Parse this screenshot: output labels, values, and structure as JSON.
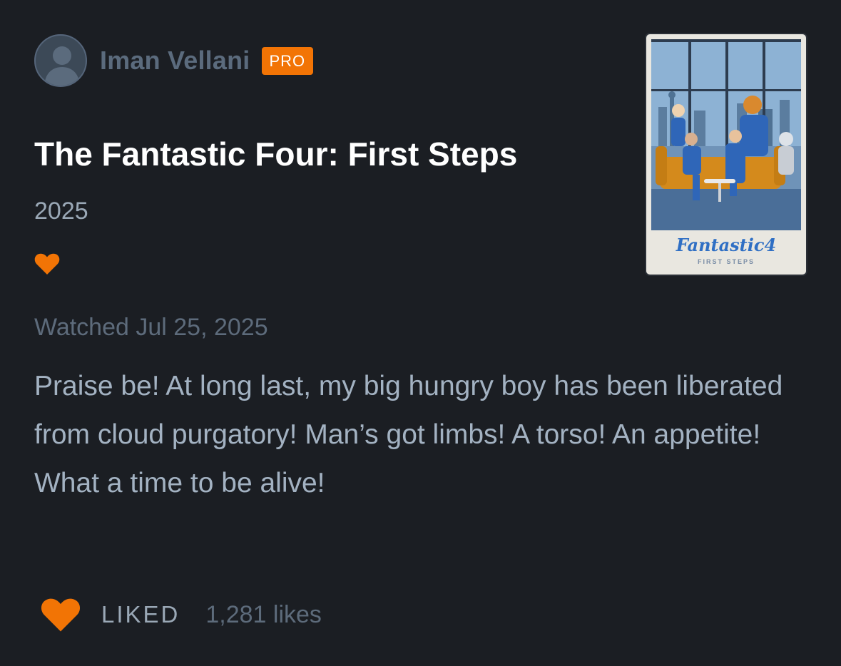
{
  "author": {
    "name": "Iman Vellani",
    "badge": "PRO"
  },
  "film": {
    "title": "The Fantastic Four: First Steps",
    "year": "2025",
    "poster": {
      "logo_text": "Fantastic4",
      "tagline": "FIRST STEPS"
    }
  },
  "review": {
    "watched_date": "Watched Jul 25, 2025",
    "text": "Praise be! At long last, my big hungry boy has been liberated from cloud purgatory! Man’s got limbs! A torso! An appetite! What a time to be alive!",
    "liked_status": "LIKED",
    "likes_count": "1,281 likes"
  },
  "icons": {
    "heart": "heart-icon",
    "avatar": "user-silhouette-icon"
  },
  "colors": {
    "background": "#1b1e23",
    "accent": "#f27405",
    "title": "#ffffff",
    "muted": "#5d6b7b",
    "body_text": "#a3b2c2"
  }
}
